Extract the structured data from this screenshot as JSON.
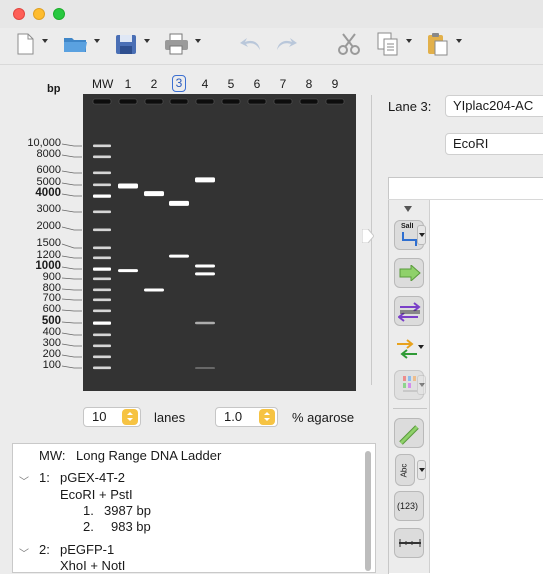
{
  "window": {
    "title": ""
  },
  "toolbar": {
    "items": [
      {
        "name": "new-document",
        "has_menu": true
      },
      {
        "name": "open-folder",
        "has_menu": true
      },
      {
        "name": "save",
        "has_menu": true
      },
      {
        "name": "print",
        "has_menu": true
      },
      {
        "name": "undo",
        "has_menu": false
      },
      {
        "name": "redo",
        "has_menu": false
      },
      {
        "name": "cut",
        "has_menu": false
      },
      {
        "name": "copy",
        "has_menu": true
      },
      {
        "name": "paste",
        "has_menu": true
      }
    ]
  },
  "gel": {
    "bp_header": "bp",
    "lanes": [
      "MW",
      "1",
      "2",
      "3",
      "4",
      "5",
      "6",
      "7",
      "8",
      "9"
    ],
    "selected_lane": "3",
    "ladder_labels": [
      {
        "text": "10,000",
        "bp": 10000,
        "bold": false
      },
      {
        "text": "8000",
        "bp": 8000,
        "bold": false
      },
      {
        "text": "6000",
        "bp": 6000,
        "bold": false
      },
      {
        "text": "5000",
        "bp": 5000,
        "bold": false
      },
      {
        "text": "4000",
        "bp": 4000,
        "bold": true
      },
      {
        "text": "3000",
        "bp": 3000,
        "bold": false
      },
      {
        "text": "2000",
        "bp": 2000,
        "bold": false
      },
      {
        "text": "1500",
        "bp": 1500,
        "bold": false
      },
      {
        "text": "1200",
        "bp": 1200,
        "bold": false
      },
      {
        "text": "1000",
        "bp": 1000,
        "bold": true
      },
      {
        "text": "900",
        "bp": 900,
        "bold": false
      },
      {
        "text": "800",
        "bp": 800,
        "bold": false
      },
      {
        "text": "700",
        "bp": 700,
        "bold": false
      },
      {
        "text": "600",
        "bp": 600,
        "bold": false
      },
      {
        "text": "500",
        "bp": 500,
        "bold": true
      },
      {
        "text": "400",
        "bp": 400,
        "bold": false
      },
      {
        "text": "300",
        "bp": 300,
        "bold": false
      },
      {
        "text": "200",
        "bp": 200,
        "bold": false
      },
      {
        "text": "100",
        "bp": 100,
        "bold": false
      }
    ],
    "lane_bands": {
      "1": [
        4900,
        983
      ],
      "2": [
        4200,
        800
      ],
      "3": [
        3500,
        1250
      ],
      "4": [
        5400,
        1050,
        950,
        500,
        100
      ]
    },
    "lanes_count": "10",
    "lanes_label": "lanes",
    "agarose": "1.0",
    "agarose_label": "% agarose"
  },
  "right": {
    "lane_label": "Lane 3:",
    "lane_name": "YIplac204-AC",
    "enzyme": "EcoRI",
    "tools": [
      {
        "name": "sali-site-tool",
        "label": "SalI"
      },
      {
        "name": "arrow-feature-tool"
      },
      {
        "name": "strand-tool"
      },
      {
        "name": "primer-tool"
      },
      {
        "name": "color-bars-tool"
      },
      {
        "name": "line-tool"
      },
      {
        "name": "text-tool",
        "label": "Abc"
      },
      {
        "name": "numbering-tool",
        "label": "(123)"
      },
      {
        "name": "ruler-tool"
      }
    ]
  },
  "lane_list": {
    "mw": {
      "label": "MW:",
      "text": "Long Range DNA Ladder"
    },
    "entries": [
      {
        "num": "1:",
        "name": "pGEX-4T-2",
        "enzymes": "EcoRI + PstI",
        "fragments": [
          {
            "n": "1.",
            "size": "3987 bp"
          },
          {
            "n": "2.",
            "size": "983 bp"
          }
        ]
      },
      {
        "num": "2:",
        "name": "pEGFP-1",
        "enzymes": "XhoI + NotI",
        "fragments": []
      }
    ]
  }
}
